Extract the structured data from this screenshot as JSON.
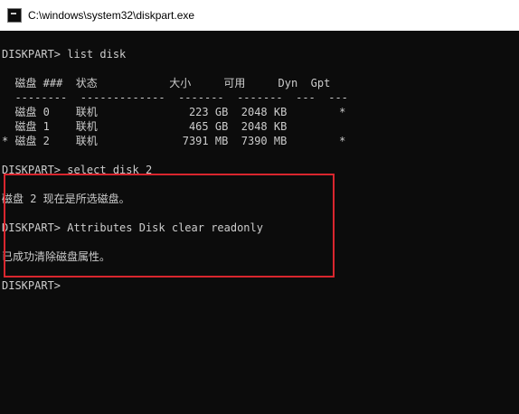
{
  "window": {
    "title": "C:\\windows\\system32\\diskpart.exe"
  },
  "console": {
    "cmd_list": "DISKPART> list disk",
    "header": "  磁盘 ###  状态           大小     可用     Dyn  Gpt",
    "separator": "  --------  -------------  -------  -------  ---  ---",
    "disks": [
      "  磁盘 0    联机              223 GB  2048 KB        *",
      "  磁盘 1    联机              465 GB  2048 KB",
      "* 磁盘 2    联机             7391 MB  7390 MB        *"
    ],
    "cmd_select": "DISKPART> select disk 2",
    "select_result": "磁盘 2 现在是所选磁盘。",
    "cmd_attributes": "DISKPART> Attributes Disk clear readonly",
    "attributes_result": "已成功清除磁盘属性。",
    "prompt": "DISKPART>"
  },
  "annotation": {
    "highlight_color": "#d9262e"
  }
}
